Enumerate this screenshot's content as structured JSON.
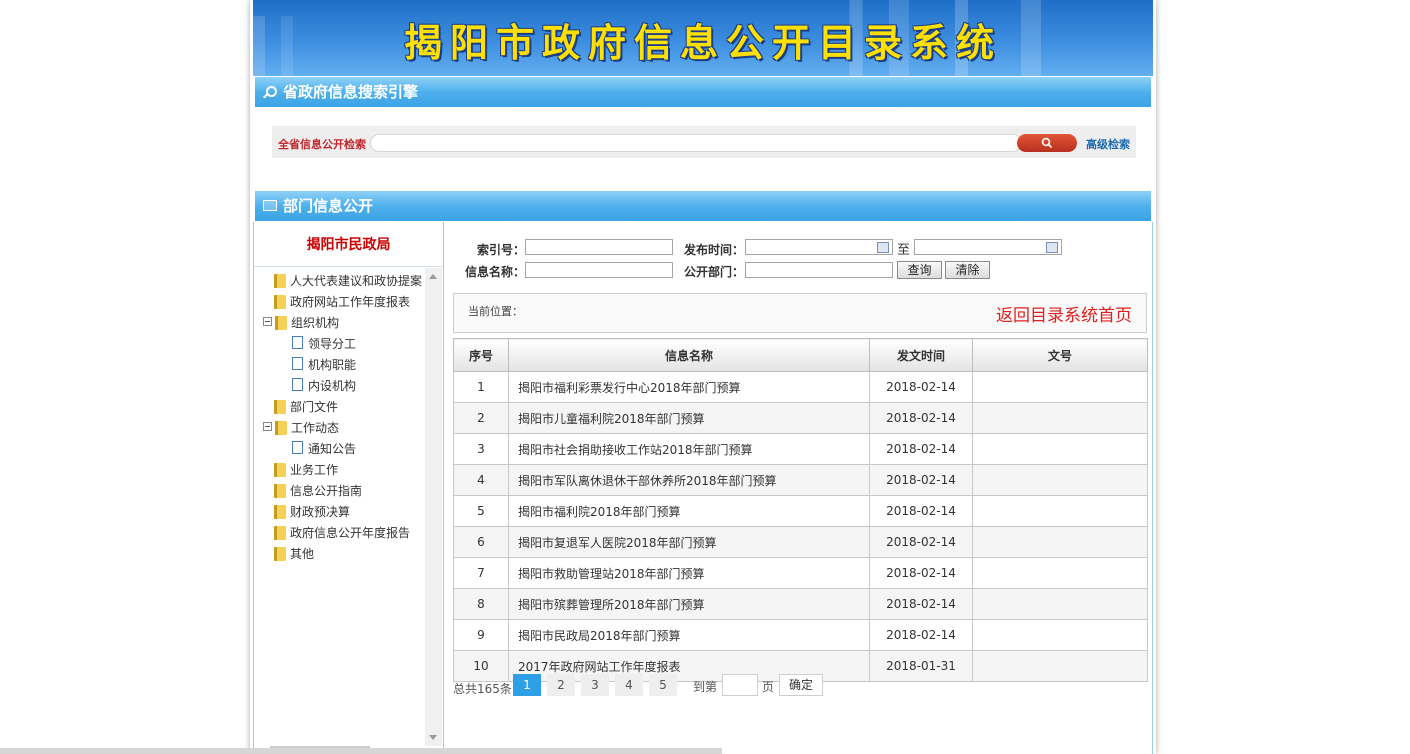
{
  "banner": {
    "title": "揭阳市政府信息公开目录系统"
  },
  "search_section": {
    "title": "省政府信息搜索引擎",
    "label": "全省信息公开检索",
    "query": "",
    "advanced": "高级检索"
  },
  "dept_section": {
    "title": "部门信息公开"
  },
  "sidebar": {
    "department": "揭阳市民政局",
    "items": [
      {
        "label": "人大代表建议和政协提案",
        "type": "folder",
        "level": 0
      },
      {
        "label": "政府网站工作年度报表",
        "type": "folder",
        "level": 0
      },
      {
        "label": "组织机构",
        "type": "folder",
        "level": 0,
        "expanded": true
      },
      {
        "label": "领导分工",
        "type": "doc",
        "level": 1
      },
      {
        "label": "机构职能",
        "type": "doc",
        "level": 1
      },
      {
        "label": "内设机构",
        "type": "doc",
        "level": 1
      },
      {
        "label": "部门文件",
        "type": "folder",
        "level": 0
      },
      {
        "label": "工作动态",
        "type": "folder",
        "level": 0,
        "expanded": true
      },
      {
        "label": "通知公告",
        "type": "doc",
        "level": 1
      },
      {
        "label": "业务工作",
        "type": "folder",
        "level": 0
      },
      {
        "label": "信息公开指南",
        "type": "folder",
        "level": 0
      },
      {
        "label": "财政预决算",
        "type": "folder",
        "level": 0
      },
      {
        "label": "政府信息公开年度报告",
        "type": "folder",
        "level": 0
      },
      {
        "label": "其他",
        "type": "folder",
        "level": 0
      }
    ]
  },
  "filters": {
    "index_label": "索引号：",
    "date_label": "发布时间：",
    "to_label": "至",
    "name_label": "信息名称：",
    "dept_label": "公开部门：",
    "query_button": "查询",
    "clear_button": "清除"
  },
  "location": {
    "current_label": "当前位置：",
    "back_link": "返回目录系统首页"
  },
  "table": {
    "headers": [
      "序号",
      "信息名称",
      "发文时间",
      "文号"
    ],
    "rows": [
      {
        "no": "1",
        "name": "揭阳市福利彩票发行中心2018年部门预算",
        "date": "2018-02-14",
        "doc_no": ""
      },
      {
        "no": "2",
        "name": "揭阳市儿童福利院2018年部门预算",
        "date": "2018-02-14",
        "doc_no": ""
      },
      {
        "no": "3",
        "name": "揭阳市社会捐助接收工作站2018年部门预算",
        "date": "2018-02-14",
        "doc_no": ""
      },
      {
        "no": "4",
        "name": "揭阳市军队离休退休干部休养所2018年部门预算",
        "date": "2018-02-14",
        "doc_no": ""
      },
      {
        "no": "5",
        "name": "揭阳市福利院2018年部门预算",
        "date": "2018-02-14",
        "doc_no": ""
      },
      {
        "no": "6",
        "name": "揭阳市复退军人医院2018年部门预算",
        "date": "2018-02-14",
        "doc_no": ""
      },
      {
        "no": "7",
        "name": "揭阳市救助管理站2018年部门预算",
        "date": "2018-02-14",
        "doc_no": ""
      },
      {
        "no": "8",
        "name": "揭阳市殡葬管理所2018年部门预算",
        "date": "2018-02-14",
        "doc_no": ""
      },
      {
        "no": "9",
        "name": "揭阳市民政局2018年部门预算",
        "date": "2018-02-14",
        "doc_no": ""
      },
      {
        "no": "10",
        "name": "2017年政府网站工作年度报表",
        "date": "2018-01-31",
        "doc_no": ""
      }
    ]
  },
  "pagination": {
    "total": "总共165条",
    "pages": [
      "1",
      "2",
      "3",
      "4",
      "5"
    ],
    "current": "1",
    "goto_label": "到第",
    "page_suffix": "页",
    "confirm": "确定"
  }
}
